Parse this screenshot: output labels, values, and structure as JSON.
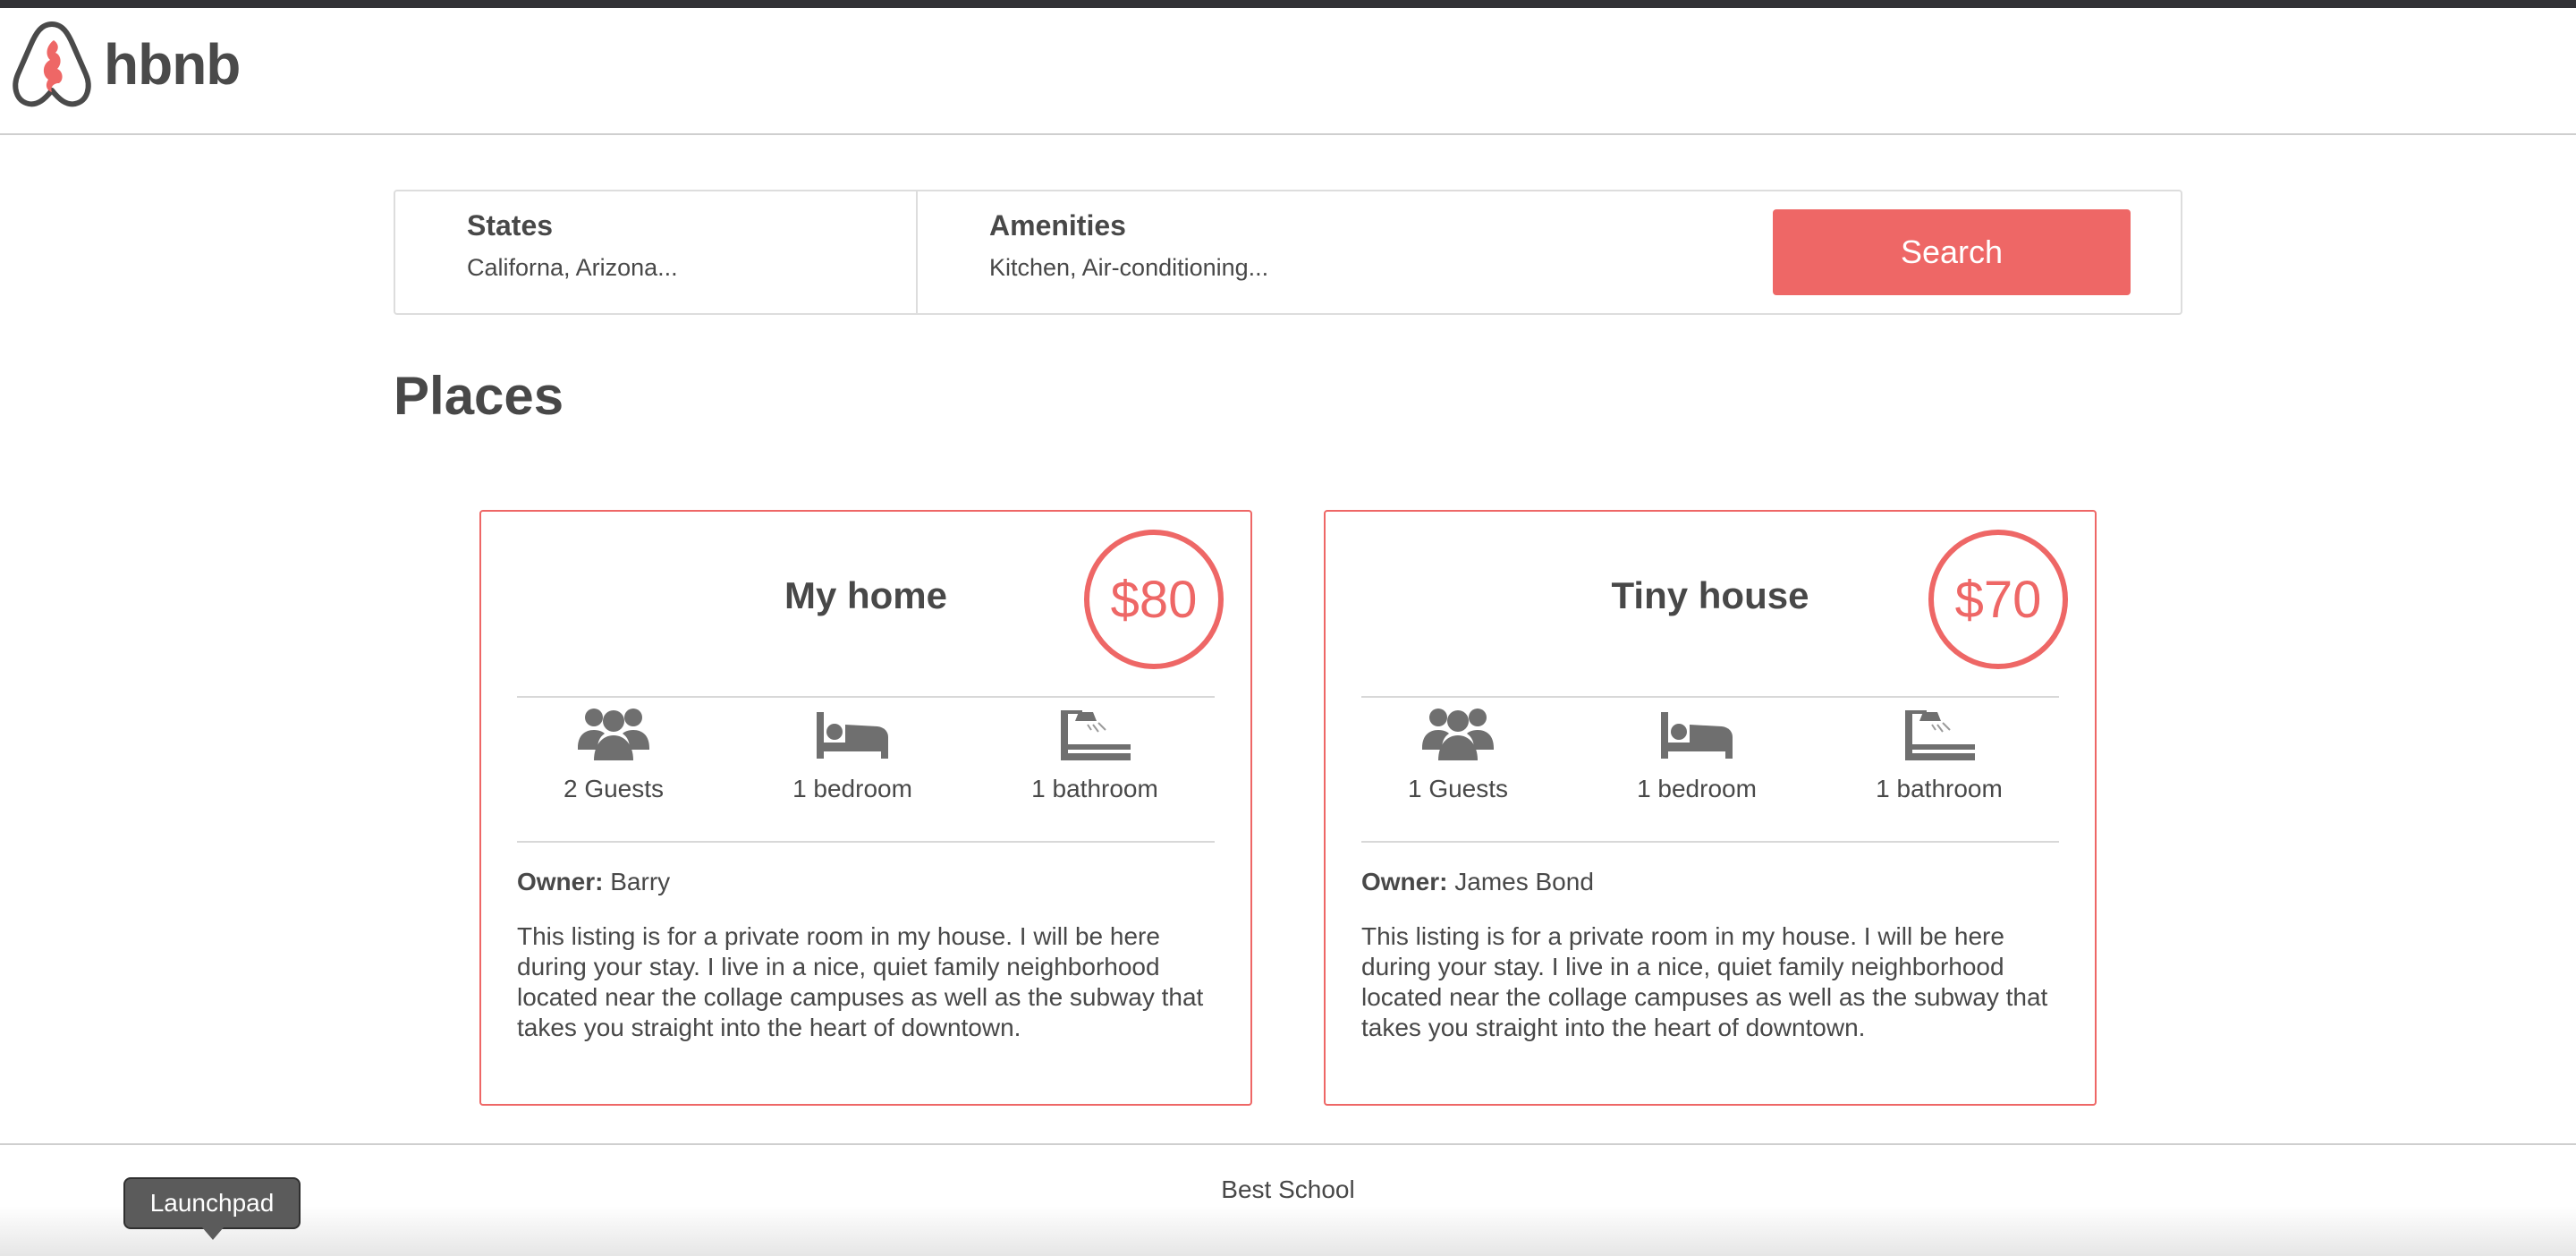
{
  "header": {
    "logo_text": "hbnb"
  },
  "filters": {
    "states": {
      "title": "States",
      "value": "Californa, Arizona..."
    },
    "amenities": {
      "title": "Amenities",
      "value": "Kitchen, Air-conditioning..."
    },
    "search_label": "Search"
  },
  "places": {
    "title": "Places",
    "items": [
      {
        "name": "My home",
        "price": "$80",
        "guests": "2 Guests",
        "bedrooms": "1 bedroom",
        "bathrooms": "1 bathroom",
        "owner_label": "Owner:",
        "owner": "Barry",
        "description": "This listing is for a private room in my house. I will be here during your stay. I live in a nice, quiet family neighborhood located near the collage campuses as well as the subway that takes you straight into the heart of downtown."
      },
      {
        "name": "Tiny house",
        "price": "$70",
        "guests": "1 Guests",
        "bedrooms": "1 bedroom",
        "bathrooms": "1 bathroom",
        "owner_label": "Owner:",
        "owner": "James Bond",
        "description": "This listing is for a private room in my house. I will be here during your stay. I live in a nice, quiet family neighborhood located near the collage campuses as well as the subway that takes you straight into the heart of downtown."
      }
    ]
  },
  "footer": {
    "text": "Best School"
  },
  "tooltip": {
    "text": "Launchpad"
  },
  "colors": {
    "accent": "#ee6766",
    "text": "#484848",
    "icon": "#6f6f6f",
    "topbar": "#323236"
  },
  "icons": [
    "logo-icon",
    "guests-icon",
    "bed-icon",
    "bath-icon"
  ]
}
